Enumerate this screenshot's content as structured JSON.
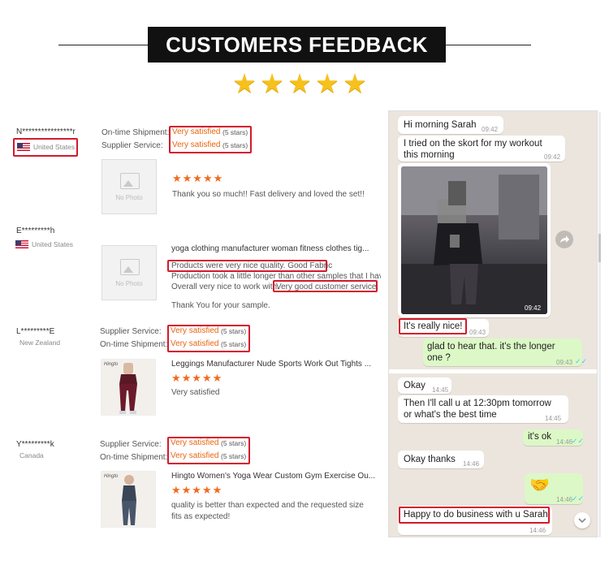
{
  "header": {
    "title": "CUSTOMERS FEEDBACK",
    "stars": "★★★★★"
  },
  "colors": {
    "accent_orange": "#e8650e",
    "highlight_red": "#d3192c",
    "star_gold": "#f7c11c",
    "chat_bg": "#ece5dd",
    "chat_out": "#dcf8c6"
  },
  "reviews": [
    {
      "user": "N****************r",
      "country": "United States",
      "rating_1_label": "On-time Shipment:",
      "rating_1_value": "Very satisfied",
      "rating_1_stars": "(5 stars)",
      "rating_2_label": "Supplier Service:",
      "rating_2_value": "Very satisfied",
      "rating_2_stars": "(5 stars)",
      "stars": "★★★★★",
      "photo_label": "No Photo",
      "comment": "Thank you so much!! Fast delivery and loved the set!!"
    },
    {
      "user": "E*********h",
      "country": "United States",
      "product": "yoga clothing manufacturer woman fitness clothes tig...",
      "photo_label": "No Photo",
      "comment_1": "Products were very nice quality. Good Fabric",
      "comment_2": "Production took a little longer than other samples that I have o",
      "comment_3a": "Overall very nice to work with.",
      "comment_3b": "Very good customer service.",
      "comment_4": "Thank You for your sample."
    },
    {
      "user": "L*********E",
      "country": "New Zealand",
      "rating_1_label": "Supplier Service:",
      "rating_1_value": "Very satisfied",
      "rating_1_stars": "(5 stars)",
      "rating_2_label": "On-time Shipment:",
      "rating_2_value": "Very satisfied",
      "rating_2_stars": "(5 stars)",
      "product": "Leggings Manufacturer Nude Sports Work Out Tights ...",
      "stars": "★★★★★",
      "comment": "Very satisfied",
      "brand": "Hingto"
    },
    {
      "user": "Y*********k",
      "country": "Canada",
      "rating_1_label": "Supplier Service:",
      "rating_1_value": "Very satisfied",
      "rating_1_stars": "(5 stars)",
      "rating_2_label": "On-time Shipment:",
      "rating_2_value": "Very satisfied",
      "rating_2_stars": "(5 stars)",
      "product": "Hingto Women's Yoga Wear Custom Gym Exercise Ou...",
      "stars": "★★★★★",
      "comment_1": "quality is better than expected and the requested size",
      "comment_2": "fits as expected!",
      "brand": "Hingto"
    }
  ],
  "chat": {
    "messages": [
      {
        "dir": "in",
        "text": "Hi morning Sarah",
        "time": "09:42"
      },
      {
        "dir": "in",
        "text_1": "I tried on the skort for my workout",
        "text_2": "this morning",
        "time": "09:42"
      },
      {
        "dir": "in",
        "type": "photo",
        "time": "09:42"
      },
      {
        "dir": "in",
        "text": "It's really nice!",
        "time": "09:43"
      },
      {
        "dir": "out",
        "text_1": "glad to hear that. it's the longer",
        "text_2": "one ?",
        "time": "09:43"
      },
      {
        "dir": "in",
        "text": "Okay",
        "time": "14:45"
      },
      {
        "dir": "in",
        "text_1": "Then I'll call u at 12:30pm tomorrow",
        "text_2": "or what's the best time",
        "time": "14:45"
      },
      {
        "dir": "out",
        "text": "it's ok",
        "time": "14:46"
      },
      {
        "dir": "in",
        "text": "Okay thanks",
        "time": "14:46"
      },
      {
        "dir": "out",
        "type": "emoji",
        "emoji": "🤝",
        "time": "14:46"
      },
      {
        "dir": "in",
        "text": "Happy to do business with u Sarah",
        "time": "14:46"
      }
    ],
    "ticks": "✓✓"
  }
}
